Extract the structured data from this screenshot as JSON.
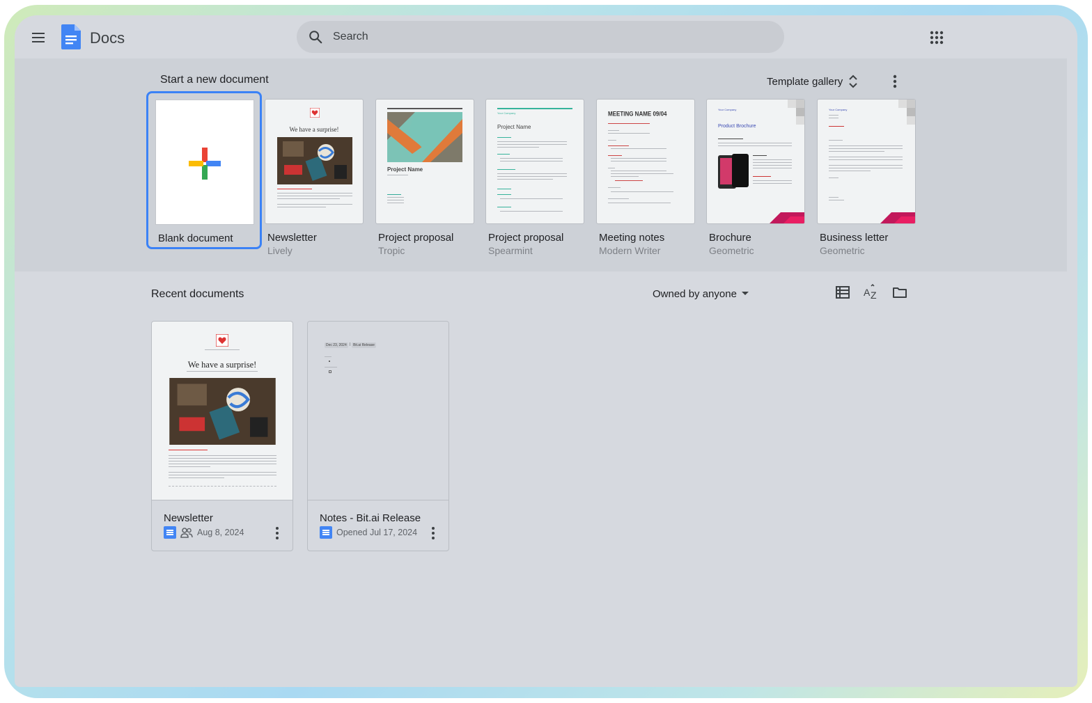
{
  "app": {
    "title": "Docs"
  },
  "search": {
    "placeholder": "Search"
  },
  "templates": {
    "heading": "Start a new document",
    "gallery_label": "Template gallery",
    "items": [
      {
        "name": "Blank document",
        "subtitle": ""
      },
      {
        "name": "Newsletter",
        "subtitle": "Lively",
        "preview_heading": "We have a surprise!"
      },
      {
        "name": "Project proposal",
        "subtitle": "Tropic",
        "preview_heading": "Project Name"
      },
      {
        "name": "Project proposal",
        "subtitle": "Spearmint",
        "preview_heading": "Project Name",
        "preview_company": "Your Company"
      },
      {
        "name": "Meeting notes",
        "subtitle": "Modern Writer",
        "preview_heading": "MEETING NAME 09/04"
      },
      {
        "name": "Brochure",
        "subtitle": "Geometric",
        "preview_heading": "Product Brochure",
        "preview_company": "Your Company"
      },
      {
        "name": "Business letter",
        "subtitle": "Geometric",
        "preview_company": "Your Company"
      }
    ]
  },
  "recent": {
    "heading": "Recent documents",
    "owner_filter": "Owned by anyone",
    "docs": [
      {
        "title": "Newsletter",
        "meta": "Aug 8, 2024",
        "shared": true,
        "preview_heading": "We have a surprise!"
      },
      {
        "title": "Notes - Bit.ai Release",
        "meta": "Opened Jul 17, 2024",
        "shared": false,
        "preview_date": "Dec 23, 2024",
        "preview_chip": "Bit.ai Release"
      }
    ]
  },
  "icons": {
    "menu": "hamburger-icon",
    "logo": "docs-logo-icon",
    "search": "search-icon",
    "apps": "apps-grid-icon",
    "sort": "unfold-icon",
    "more": "more-vert-icon",
    "list_view": "list-view-icon",
    "sort_az": "sort-az-icon",
    "folder": "folder-icon"
  },
  "colors": {
    "accent": "#3b82f6",
    "docs_blue": "#4285f4",
    "background": "#d6d9df"
  }
}
